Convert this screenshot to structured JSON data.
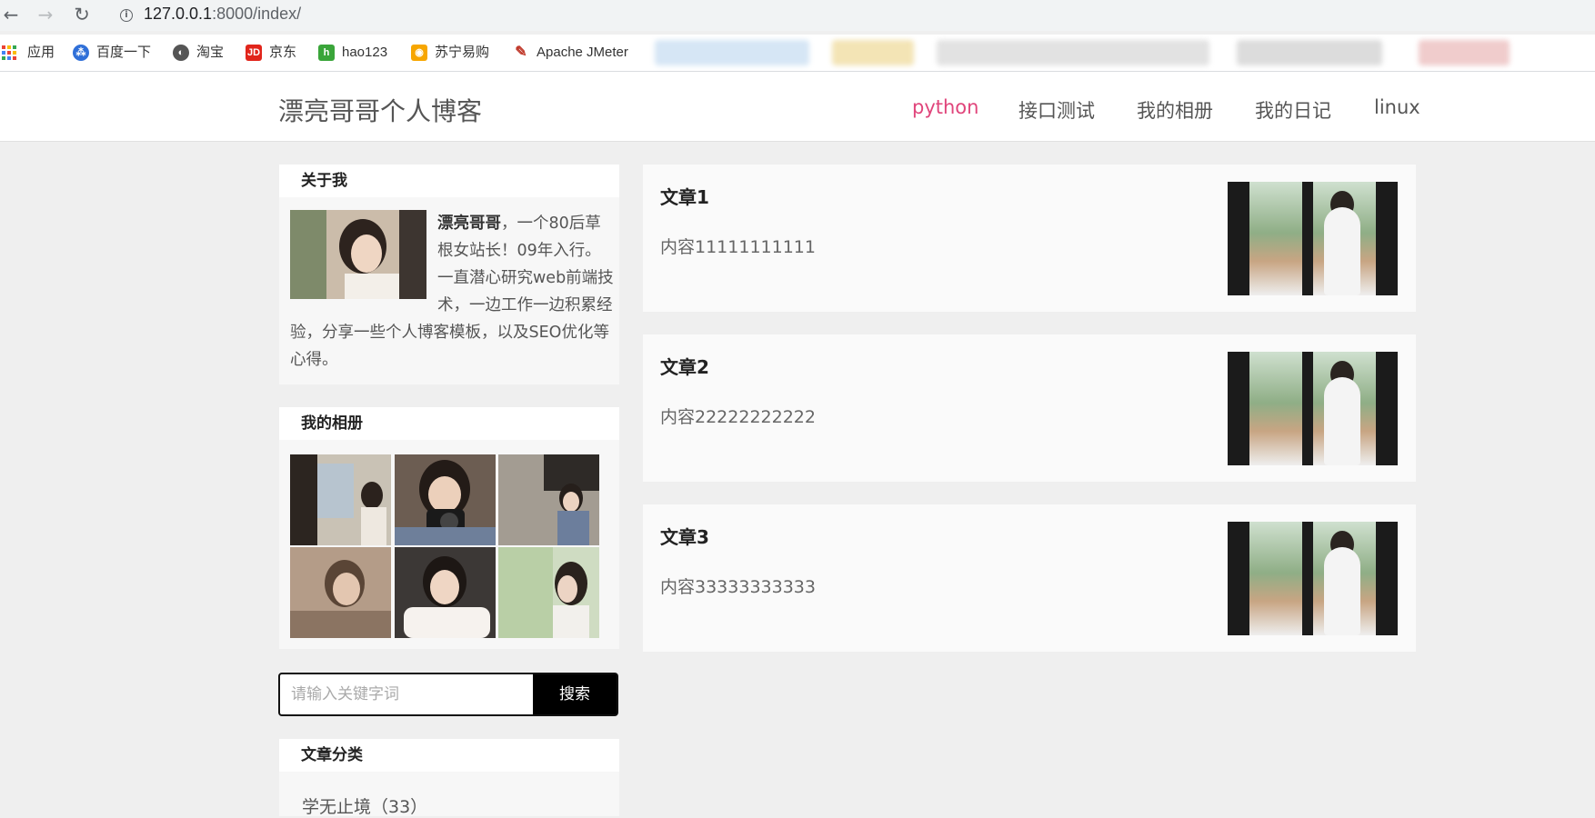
{
  "browser": {
    "url_host": "127.0.0.1",
    "url_rest": ":8000/index/",
    "bookmarks": [
      {
        "label": "应用",
        "icon": "apps-icon"
      },
      {
        "label": "百度一下",
        "icon": "baidu-icon"
      },
      {
        "label": "淘宝",
        "icon": "globe-icon"
      },
      {
        "label": "京东",
        "icon": "jd-icon"
      },
      {
        "label": "hao123",
        "icon": "hao123-icon"
      },
      {
        "label": "苏宁易购",
        "icon": "suning-icon"
      },
      {
        "label": "Apache JMeter",
        "icon": "jmeter-icon"
      }
    ]
  },
  "header": {
    "site_title": "漂亮哥哥个人博客",
    "nav": [
      "python",
      "接口测试",
      "我的相册",
      "我的日记",
      "linux"
    ],
    "active_nav": "python",
    "active_color": "#e0457b"
  },
  "sidebar": {
    "about": {
      "heading": "关于我",
      "name": "漂亮哥哥",
      "text": "，一个80后草根女站长！09年入行。一直潜心研究web前端技术，一边工作一边积累经验，分享一些个人博客模板，以及SEO优化等心得。"
    },
    "album": {
      "heading": "我的相册"
    },
    "search": {
      "placeholder": "请输入关键字词",
      "button": "搜索"
    },
    "categories": {
      "heading": "文章分类",
      "items": [
        "学无止境（33）"
      ]
    }
  },
  "articles": [
    {
      "title": "文章1",
      "content": "内容11111111111"
    },
    {
      "title": "文章2",
      "content": "内容22222222222"
    },
    {
      "title": "文章3",
      "content": "内容33333333333"
    }
  ]
}
